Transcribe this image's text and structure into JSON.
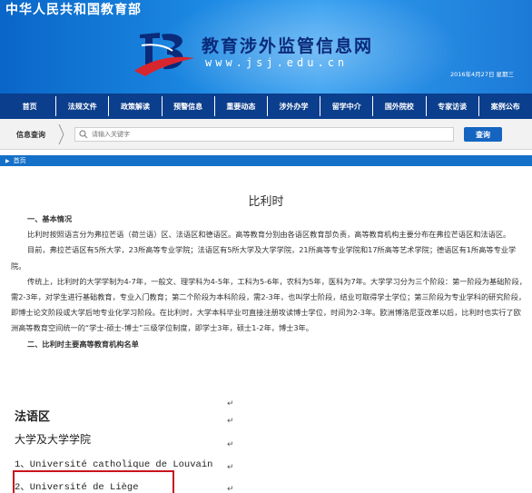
{
  "header": {
    "ministry": "中华人民共和国教育部",
    "site_title": "教育涉外监管信息网",
    "site_url": "www.jsj.edu.cn",
    "date": "2016年4月27日 星期三",
    "colors": {
      "banner_blue": "#1a86e0",
      "nav_blue": "#0b3e8c",
      "title_navy": "#0a2a7a",
      "accent_red": "#c8141e"
    }
  },
  "nav": {
    "items": [
      {
        "label": "首页"
      },
      {
        "label": "法规文件"
      },
      {
        "label": "政策解读"
      },
      {
        "label": "预警信息"
      },
      {
        "label": "重要动态"
      },
      {
        "label": "涉外办学"
      },
      {
        "label": "留学中介"
      },
      {
        "label": "国外院校"
      },
      {
        "label": "专家访谈"
      },
      {
        "label": "案例公布"
      }
    ]
  },
  "search": {
    "label": "信息查询",
    "placeholder": "请输入关键字",
    "button": "查询"
  },
  "breadcrumb": {
    "home": "首页"
  },
  "article": {
    "title": "比利时",
    "section1_heading": "一、基本情况",
    "p1": "比利时按照语言分为弗拉芒语（荷兰语）区、法语区和德语区。高等教育分别由各语区教育部负责，高等教育机构主要分布在弗拉芒语区和法语区。",
    "p2": "目前，弗拉芒语区有5所大学，23所高等专业学院；法语区有5所大学及大学学院，21所高等专业学院和17所高等艺术学院；德语区有1所高等专业学院。",
    "p3": "传统上，比利时的大学学制为4-7年，一般文、理学科为4-5年，工科为5-6年，农科为5年，医科为7年。大学学习分为三个阶段：第一阶段为基础阶段，需2-3年，对学生进行基础教育，专业入门教育；第二个阶段为本科阶段，需2-3年，也叫学士阶段，结业可取得学士学位；第三阶段为专业学科的研究阶段，即博士论文阶段或大学后地专业化学习阶段。在比利时，大学本科毕业可直接注册攻读博士学位，时间为2-3年。欧洲博洛尼亚改革以后，比利时也实行了欧洲高等教育空间统一的“学士-硕士-博士”三级学位制度，即学士3年，硕士1-2年，博士3年。",
    "section2_heading": "二、比利时主要高等教育机构名单"
  },
  "doc": {
    "return_mark": "↵",
    "region": "法语区",
    "category": "大学及大学学院",
    "items": [
      "1、Université catholique de Louvain",
      "2、Université de Liège"
    ]
  }
}
